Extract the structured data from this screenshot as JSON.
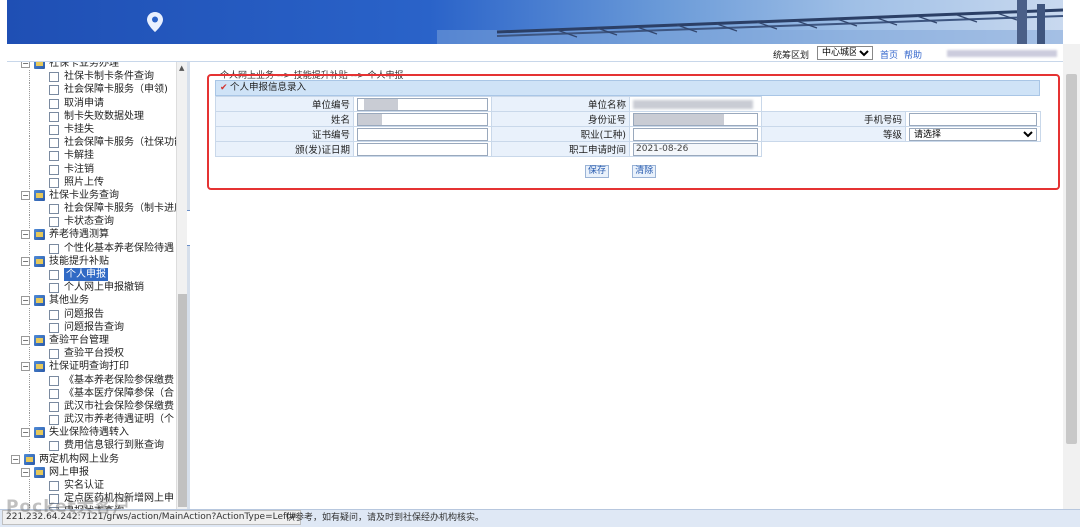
{
  "header": {
    "area_label": "统筹区划",
    "area_select": "中心城区",
    "home_link": "首页",
    "help_link": "帮助"
  },
  "sidebar": {
    "items": [
      {
        "label": "社保卡业务办理",
        "level": 1,
        "type": "folder"
      },
      {
        "label": "社保卡制卡条件查询",
        "level": 2,
        "type": "leaf"
      },
      {
        "label": "社会保障卡服务（申领)",
        "level": 2,
        "type": "leaf"
      },
      {
        "label": "取消申请",
        "level": 2,
        "type": "leaf"
      },
      {
        "label": "制卡失败数据处理",
        "level": 2,
        "type": "leaf"
      },
      {
        "label": "卡挂失",
        "level": 2,
        "type": "leaf"
      },
      {
        "label": "社会保障卡服务（社保功能",
        "level": 2,
        "type": "leaf"
      },
      {
        "label": "卡解挂",
        "level": 2,
        "type": "leaf"
      },
      {
        "label": "卡注销",
        "level": 2,
        "type": "leaf"
      },
      {
        "label": "照片上传",
        "level": 2,
        "type": "leaf"
      },
      {
        "label": "社保卡业务查询",
        "level": 1,
        "type": "folder"
      },
      {
        "label": "社会保障卡服务（制卡进度",
        "level": 2,
        "type": "leaf"
      },
      {
        "label": "卡状态查询",
        "level": 2,
        "type": "leaf"
      },
      {
        "label": "养老待遇测算",
        "level": 1,
        "type": "folder"
      },
      {
        "label": "个性化基本养老保险待遇",
        "level": 2,
        "type": "leaf"
      },
      {
        "label": "技能提升补贴",
        "level": 1,
        "type": "folder"
      },
      {
        "label": "个人申报",
        "level": 2,
        "type": "leaf",
        "selected": true
      },
      {
        "label": "个人网上申报撤销",
        "level": 2,
        "type": "leaf"
      },
      {
        "label": "其他业务",
        "level": 1,
        "type": "folder"
      },
      {
        "label": "问题报告",
        "level": 2,
        "type": "leaf"
      },
      {
        "label": "问题报告查询",
        "level": 2,
        "type": "leaf"
      },
      {
        "label": "查验平台管理",
        "level": 1,
        "type": "folder"
      },
      {
        "label": "查验平台授权",
        "level": 2,
        "type": "leaf"
      },
      {
        "label": "社保证明查询打印",
        "level": 1,
        "type": "folder"
      },
      {
        "label": "《基本养老保险参保缴费",
        "level": 2,
        "type": "leaf"
      },
      {
        "label": "《基本医疗保障参保（合",
        "level": 2,
        "type": "leaf"
      },
      {
        "label": "武汉市社会保险参保缴费",
        "level": 2,
        "type": "leaf"
      },
      {
        "label": "武汉市养老待遇证明（个",
        "level": 2,
        "type": "leaf"
      },
      {
        "label": "失业保险待遇转入",
        "level": 1,
        "type": "folder"
      },
      {
        "label": "费用信息银行到账查询",
        "level": 2,
        "type": "leaf"
      },
      {
        "label": "两定机构网上业务",
        "level": 0,
        "type": "folder"
      },
      {
        "label": "网上申报",
        "level": 1,
        "type": "folder"
      },
      {
        "label": "实名认证",
        "level": 2,
        "type": "leaf"
      },
      {
        "label": "定点医药机构新增网上申",
        "level": 2,
        "type": "leaf"
      },
      {
        "label": "申报状态查询",
        "level": 2,
        "type": "leaf"
      }
    ]
  },
  "main": {
    "breadcrumb": "个人网上业务 --> 技能提升补贴 --> 个人申报",
    "panel_title": "个人申报信息录入",
    "fields": {
      "unit_no_label": "单位编号",
      "unit_name_label": "单位名称",
      "name_label": "姓名",
      "id_no_label": "身份证号",
      "phone_label": "手机号码",
      "cert_no_label": "证书编号",
      "occupation_label": "职业(工种)",
      "level_label": "等级",
      "level_value": "请选择",
      "issue_date_label": "颁(发)证日期",
      "apply_time_label": "职工申请时间",
      "apply_time_value": "2021-08-26"
    },
    "save_button": "保存",
    "clear_button": "清除"
  },
  "status": {
    "url": "221.232.64.242:7121/grws/action/MainAction?ActionType=Left#",
    "notice": "供参考，如有疑问，请及时到社保经办机构核实。"
  },
  "watermark": "Pocket大客户"
}
